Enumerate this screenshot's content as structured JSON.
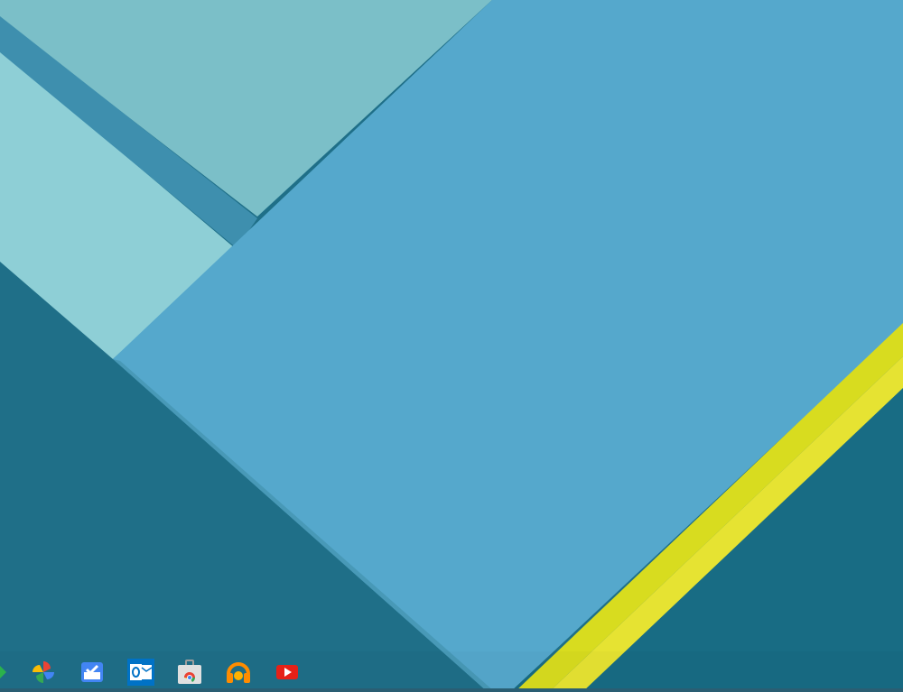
{
  "wallpaper": {
    "colors": {
      "base_dark": "#1f6f88",
      "lower_band": "#186c84",
      "pale_panel": "#8ecfd6",
      "pale_panel_top": "#7bbfc8",
      "stripe": "#3e8fae",
      "main_panel": "#55a8cc",
      "yellow_band": "#d8dc1f",
      "yellow_band_light": "#e6e332"
    }
  },
  "shelf": {
    "apps": [
      {
        "name": "feedly-icon",
        "color": "#2bb24c"
      },
      {
        "name": "google-photos-icon",
        "color": "#fbbc05"
      },
      {
        "name": "inbox-icon",
        "color": "#4285f4"
      },
      {
        "name": "outlook-icon",
        "color": "#0072c6"
      },
      {
        "name": "chrome-web-store-icon",
        "color": "#e0e0e0"
      },
      {
        "name": "google-play-music-icon",
        "color": "#ff8c00"
      },
      {
        "name": "youtube-icon",
        "color": "#e62117"
      }
    ]
  }
}
